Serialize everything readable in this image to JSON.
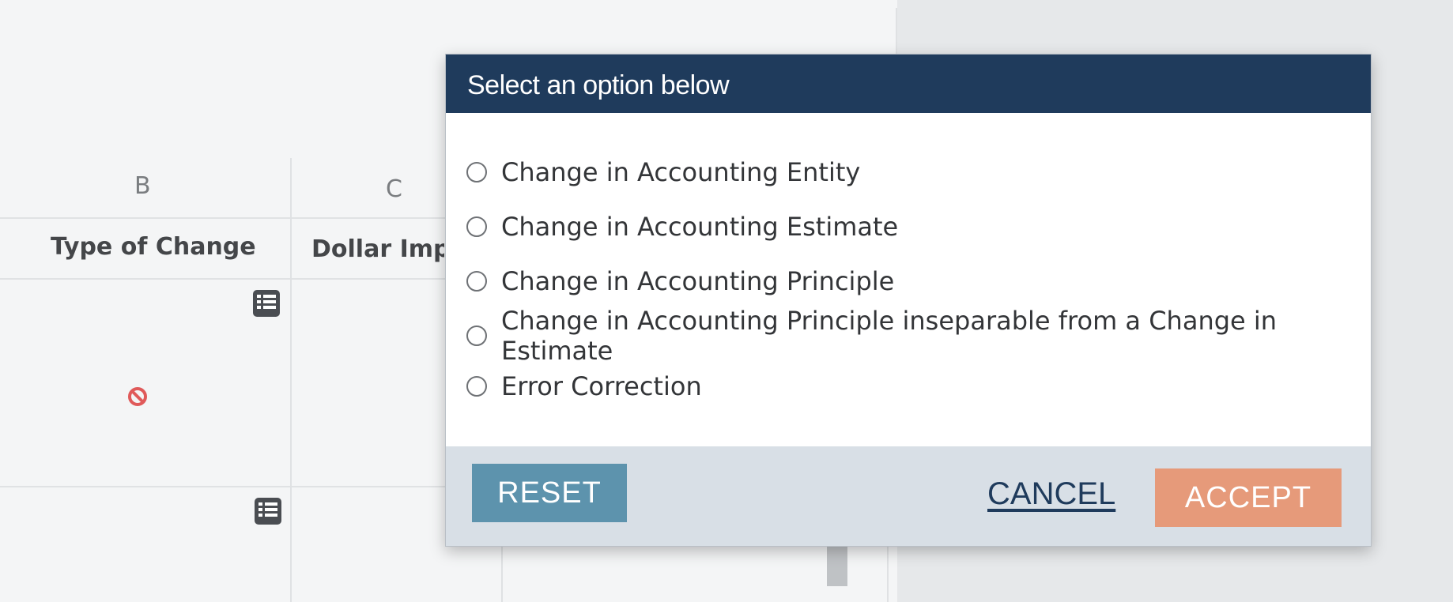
{
  "sheet": {
    "col_b_letter": "B",
    "col_c_letter": "C",
    "col_b_header": "Type of Change",
    "col_c_header": "Dollar Impact"
  },
  "icons": {
    "list": "list-icon",
    "blocked": "no-entry-icon"
  },
  "modal": {
    "title": "Select an option below",
    "options": [
      {
        "label": "Change in Accounting Entity"
      },
      {
        "label": "Change in Accounting Estimate"
      },
      {
        "label": "Change in Accounting Principle"
      },
      {
        "label": "Change in Accounting Principle inseparable from a Change in Estimate"
      },
      {
        "label": "Error Correction"
      }
    ],
    "reset_label": "RESET",
    "cancel_label": "CANCEL",
    "accept_label": "ACCEPT"
  },
  "colors": {
    "header_bg": "#1f3b5c",
    "reset_bg": "#5d93ad",
    "accept_bg": "#e69a7a",
    "footer_bg": "#d8dfe6"
  }
}
